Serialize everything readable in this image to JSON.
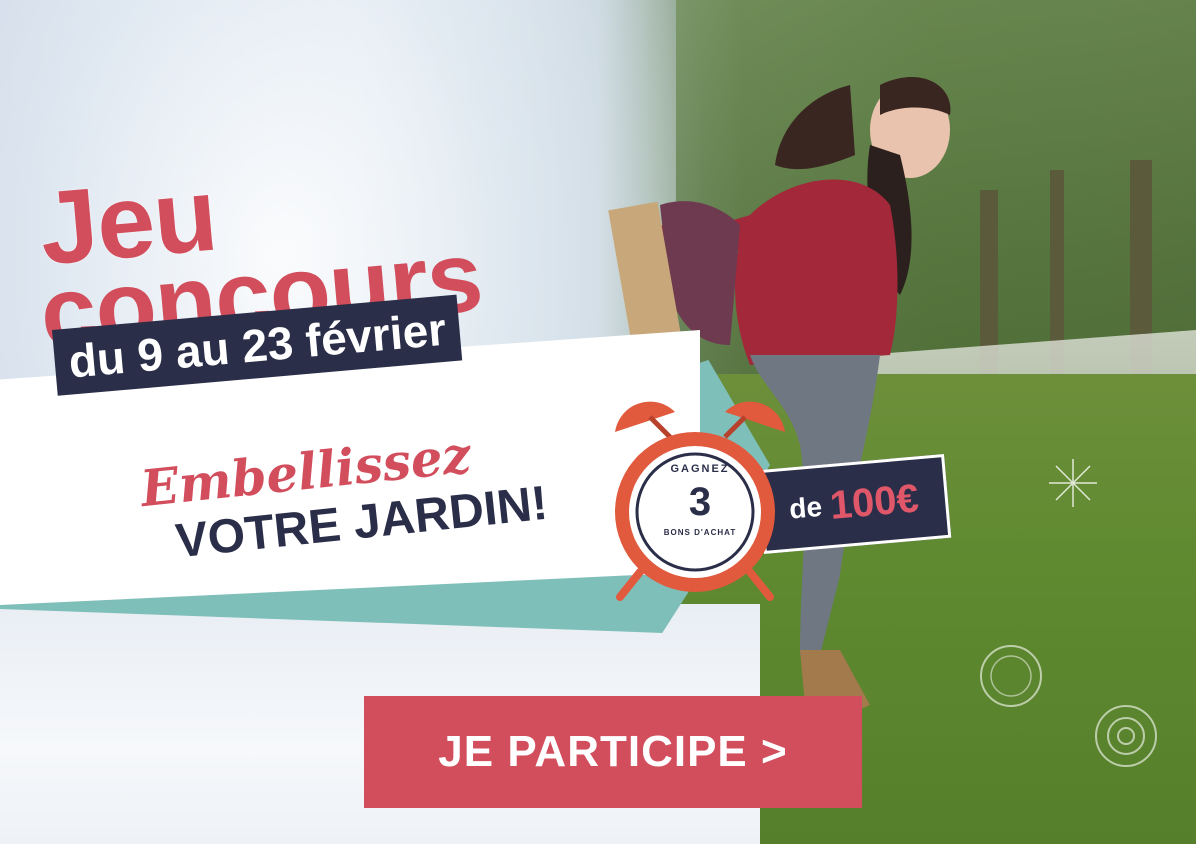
{
  "banner": {
    "title_line1": "Jeu",
    "title_line2": "concours",
    "dates": "du 9 au 23 février",
    "slogan_line1": "Embellissez",
    "slogan_line2": "VOTRE JARDIN!"
  },
  "prize": {
    "gagnez": "GAGNEZ",
    "count": "3",
    "bons": "BONS D'ACHAT",
    "de": "de",
    "amount": "100€"
  },
  "cta": {
    "label": "JE PARTICIPE >"
  },
  "colors": {
    "brand_red": "#d24e5d",
    "navy": "#2b2e48",
    "teal": "#7fbfb9"
  }
}
